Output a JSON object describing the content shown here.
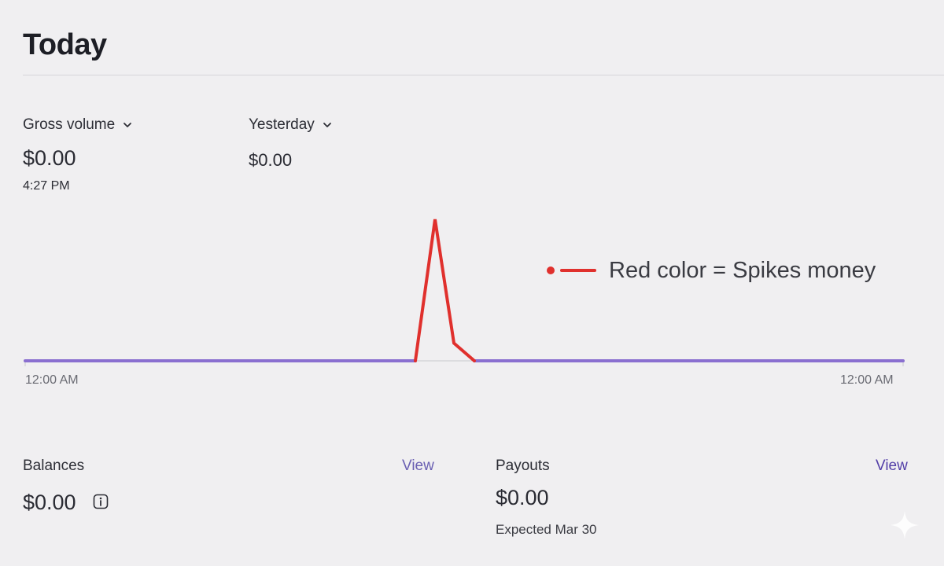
{
  "page": {
    "title": "Today"
  },
  "metrics": {
    "gross": {
      "label": "Gross volume",
      "value": "$0.00",
      "time": "4:27 PM"
    },
    "compare": {
      "label": "Yesterday",
      "value": "$0.00"
    }
  },
  "chart_data": {
    "type": "line",
    "x_start_label": "12:00 AM",
    "x_end_label": "12:00 AM",
    "series": [
      {
        "values": [
          0,
          0
        ],
        "color": "#8a6fd0"
      },
      {
        "values": [
          0,
          0.8,
          0.1,
          0
        ],
        "color": "#e0302d"
      }
    ],
    "legend": [
      {
        "label": "Red color = Spikes money",
        "color": "#e0302d"
      }
    ]
  },
  "balances": {
    "label": "Balances",
    "value": "$0.00",
    "view_label": "View",
    "info_icon": "info-icon"
  },
  "payouts": {
    "label": "Payouts",
    "value": "$0.00",
    "caption": "Expected Mar 30",
    "view_label": "View"
  },
  "colors": {
    "accent": "#635bff",
    "link": "#6a5fb2",
    "baseline": "#8a6fd0",
    "spike": "#e0302d"
  }
}
